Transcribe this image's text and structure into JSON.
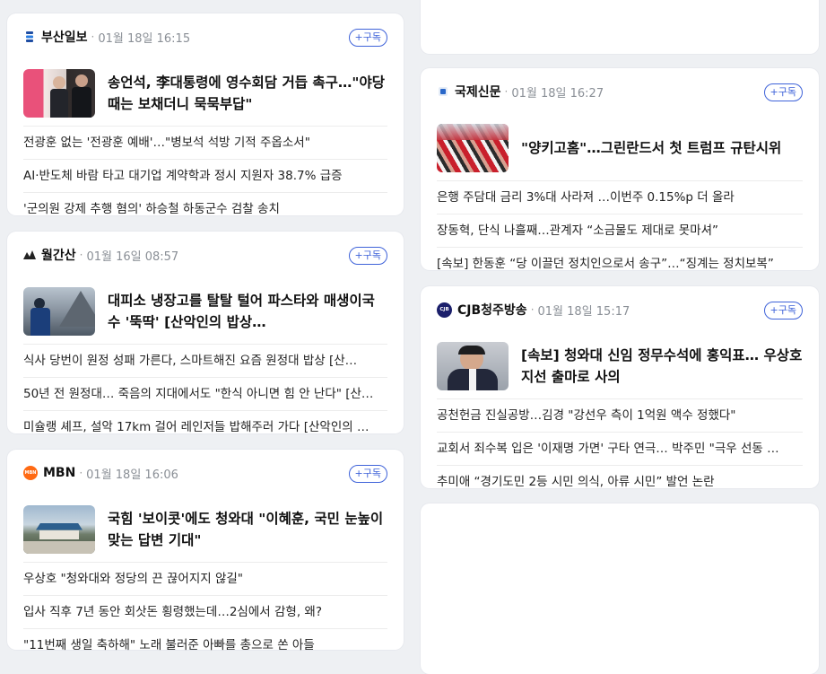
{
  "cards": {
    "busan": {
      "press": "부산일보",
      "time": "01월 18일 16:15",
      "subscribe": "+구독",
      "headline": "송언석, 李대통령에 영수회담 거듭 촉구…\"야당 때는 보채더니 묵묵부답\"",
      "items": [
        "전광훈 없는 '전광훈 예배'…\"병보석 석방 기적 주옵소서\"",
        "AI·반도체 바람 타고 대기업 계약학과 정시 지원자 38.7% 급증",
        "'군의원 강제 추행 혐의' 하승철 하동군수 검찰 송치"
      ]
    },
    "wolgan": {
      "press": "월간산",
      "time": "01월 16일 08:57",
      "subscribe": "+구독",
      "headline": "대피소 냉장고를 탈탈 털어 파스타와 매생이국수 '뚝딱' [산악인의 밥상…",
      "items": [
        "식사 당번이 원정 성패 가른다, 스마트해진 요즘 원정대 밥상 [산…",
        "50년 전 원정대… 죽음의 지대에서도 \"한식 아니면 힘 안 난다\" [산…",
        "미슐랭 셰프, 설악 17km 걸어 레인저들 밥해주러 가다 [산악인의 …"
      ]
    },
    "mbn": {
      "press": "MBN",
      "logo_text": "MBN",
      "time": "01월 18일 16:06",
      "subscribe": "+구독",
      "headline": "국힘 '보이콧'에도 청와대 \"이혜훈, 국민 눈높이 맞는 답변 기대\"",
      "items": [
        "우상호 \"청와대와 정당의 끈 끊어지지 않길\"",
        "입사 직후 7년 동안 회삿돈 횡령했는데…2심에서 감형, 왜?",
        "\"11번째 생일 축하해\" 노래 불러준 아빠를 총으로 쏜 아들"
      ]
    },
    "kookje": {
      "press": "국제신문",
      "time": "01월 18일 16:27",
      "subscribe": "+구독",
      "headline": "\"양키고홈\"…그린란드서 첫 트럼프 규탄시위",
      "items": [
        "은행 주담대 금리 3%대 사라져 …이번주 0.15%p 더 올라",
        "장동혁, 단식 나흘째…관계자 “소금물도 제대로 못마셔”",
        "[속보] 한동훈 “당 이끌던 정치인으로서 송구”…“징계는 정치보복”"
      ]
    },
    "cjb": {
      "press": "CJB청주방송",
      "logo_text": "CJB",
      "time": "01월 18일 15:17",
      "subscribe": "+구독",
      "headline": "[속보] 청와대 신임 정무수석에 홍익표… 우상호 지선 출마로 사의",
      "items": [
        "공천헌금 진실공방…김경 \"강선우 측이 1억원 액수 정했다\"",
        "교회서 죄수복 입은 '이재명 가면' 구타 연극… 박주민 \"극우 선동 …",
        "추미애 “경기도민 2등 시민 의식, 아류 시민” 발언 논란"
      ]
    }
  }
}
